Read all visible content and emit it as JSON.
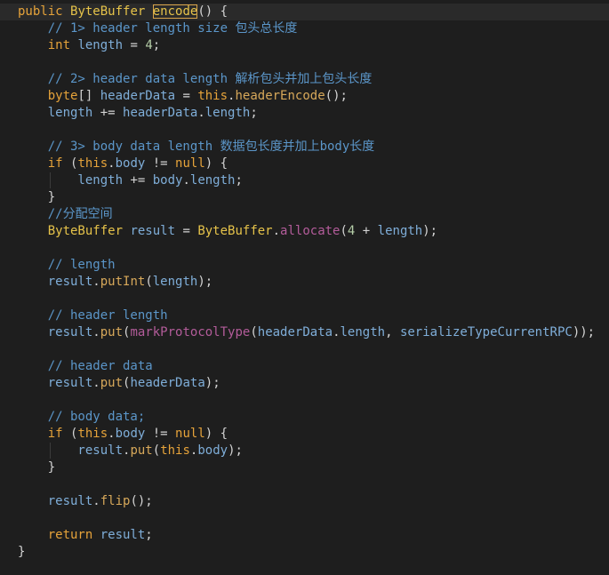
{
  "editor": {
    "lines": [
      {
        "tokens": [
          {
            "t": "public ",
            "c": "kw"
          },
          {
            "t": "ByteBuffer ",
            "c": "type"
          },
          {
            "t": "encode",
            "c": "sel"
          },
          {
            "t": "() {",
            "c": "pl"
          }
        ]
      },
      {
        "tokens": [
          {
            "t": "    // 1> header length size ",
            "c": "cm"
          },
          {
            "t": "包头总长度",
            "c": "cm"
          }
        ]
      },
      {
        "tokens": [
          {
            "t": "    int ",
            "c": "kw"
          },
          {
            "t": "length",
            "c": "var"
          },
          {
            "t": " = ",
            "c": "pl"
          },
          {
            "t": "4",
            "c": "num"
          },
          {
            "t": ";",
            "c": "pl"
          }
        ]
      },
      {
        "tokens": [
          {
            "t": "",
            "c": "pl"
          }
        ]
      },
      {
        "tokens": [
          {
            "t": "    // 2> header data length ",
            "c": "cm"
          },
          {
            "t": "解析包头并加上包头长度",
            "c": "cm"
          }
        ]
      },
      {
        "tokens": [
          {
            "t": "    byte",
            "c": "kw"
          },
          {
            "t": "[] ",
            "c": "pl"
          },
          {
            "t": "headerData",
            "c": "var"
          },
          {
            "t": " = ",
            "c": "pl"
          },
          {
            "t": "this",
            "c": "kw"
          },
          {
            "t": ".",
            "c": "pl"
          },
          {
            "t": "headerEncode",
            "c": "call"
          },
          {
            "t": "();",
            "c": "pl"
          }
        ]
      },
      {
        "tokens": [
          {
            "t": "    length",
            "c": "var"
          },
          {
            "t": " += ",
            "c": "pl"
          },
          {
            "t": "headerData",
            "c": "var"
          },
          {
            "t": ".",
            "c": "pl"
          },
          {
            "t": "length",
            "c": "field"
          },
          {
            "t": ";",
            "c": "pl"
          }
        ]
      },
      {
        "tokens": [
          {
            "t": "",
            "c": "pl"
          }
        ]
      },
      {
        "tokens": [
          {
            "t": "    // 3> body data length ",
            "c": "cm"
          },
          {
            "t": "数据包长度并加上body长度",
            "c": "cm"
          }
        ]
      },
      {
        "tokens": [
          {
            "t": "    if ",
            "c": "kw"
          },
          {
            "t": "(",
            "c": "pl"
          },
          {
            "t": "this",
            "c": "kw"
          },
          {
            "t": ".",
            "c": "pl"
          },
          {
            "t": "body",
            "c": "field"
          },
          {
            "t": " != ",
            "c": "pl"
          },
          {
            "t": "null",
            "c": "kw"
          },
          {
            "t": ") {",
            "c": "pl"
          }
        ]
      },
      {
        "tokens": [
          {
            "t": "        length",
            "c": "var"
          },
          {
            "t": " += ",
            "c": "pl"
          },
          {
            "t": "body",
            "c": "var"
          },
          {
            "t": ".",
            "c": "pl"
          },
          {
            "t": "length",
            "c": "field"
          },
          {
            "t": ";",
            "c": "pl"
          }
        ]
      },
      {
        "tokens": [
          {
            "t": "    }",
            "c": "pl"
          }
        ]
      },
      {
        "tokens": [
          {
            "t": "    //分配空间",
            "c": "cm"
          }
        ]
      },
      {
        "tokens": [
          {
            "t": "    ByteBuffer ",
            "c": "type"
          },
          {
            "t": "result",
            "c": "var"
          },
          {
            "t": " = ",
            "c": "pl"
          },
          {
            "t": "ByteBuffer",
            "c": "type"
          },
          {
            "t": ".",
            "c": "pl"
          },
          {
            "t": "allocate",
            "c": "deco"
          },
          {
            "t": "(",
            "c": "pl"
          },
          {
            "t": "4",
            "c": "num"
          },
          {
            "t": " + ",
            "c": "pl"
          },
          {
            "t": "length",
            "c": "var"
          },
          {
            "t": ");",
            "c": "pl"
          }
        ]
      },
      {
        "tokens": [
          {
            "t": "",
            "c": "pl"
          }
        ]
      },
      {
        "tokens": [
          {
            "t": "    // length",
            "c": "cm"
          }
        ]
      },
      {
        "tokens": [
          {
            "t": "    result",
            "c": "var"
          },
          {
            "t": ".",
            "c": "pl"
          },
          {
            "t": "putInt",
            "c": "call"
          },
          {
            "t": "(",
            "c": "pl"
          },
          {
            "t": "length",
            "c": "var"
          },
          {
            "t": ");",
            "c": "pl"
          }
        ]
      },
      {
        "tokens": [
          {
            "t": "",
            "c": "pl"
          }
        ]
      },
      {
        "tokens": [
          {
            "t": "    // header length",
            "c": "cm"
          }
        ]
      },
      {
        "tokens": [
          {
            "t": "    result",
            "c": "var"
          },
          {
            "t": ".",
            "c": "pl"
          },
          {
            "t": "put",
            "c": "call"
          },
          {
            "t": "(",
            "c": "pl"
          },
          {
            "t": "markProtocolType",
            "c": "deco"
          },
          {
            "t": "(",
            "c": "pl"
          },
          {
            "t": "headerData",
            "c": "var"
          },
          {
            "t": ".",
            "c": "pl"
          },
          {
            "t": "length",
            "c": "field"
          },
          {
            "t": ", ",
            "c": "pl"
          },
          {
            "t": "serializeTypeCurrentRPC",
            "c": "var"
          },
          {
            "t": "));",
            "c": "pl"
          }
        ]
      },
      {
        "tokens": [
          {
            "t": "",
            "c": "pl"
          }
        ]
      },
      {
        "tokens": [
          {
            "t": "    // header data",
            "c": "cm"
          }
        ]
      },
      {
        "tokens": [
          {
            "t": "    result",
            "c": "var"
          },
          {
            "t": ".",
            "c": "pl"
          },
          {
            "t": "put",
            "c": "call"
          },
          {
            "t": "(",
            "c": "pl"
          },
          {
            "t": "headerData",
            "c": "var"
          },
          {
            "t": ");",
            "c": "pl"
          }
        ]
      },
      {
        "tokens": [
          {
            "t": "",
            "c": "pl"
          }
        ]
      },
      {
        "tokens": [
          {
            "t": "    // body data;",
            "c": "cm"
          }
        ]
      },
      {
        "tokens": [
          {
            "t": "    if ",
            "c": "kw"
          },
          {
            "t": "(",
            "c": "pl"
          },
          {
            "t": "this",
            "c": "kw"
          },
          {
            "t": ".",
            "c": "pl"
          },
          {
            "t": "body",
            "c": "field"
          },
          {
            "t": " != ",
            "c": "pl"
          },
          {
            "t": "null",
            "c": "kw"
          },
          {
            "t": ") {",
            "c": "pl"
          }
        ]
      },
      {
        "tokens": [
          {
            "t": "        result",
            "c": "var"
          },
          {
            "t": ".",
            "c": "pl"
          },
          {
            "t": "put",
            "c": "call"
          },
          {
            "t": "(",
            "c": "pl"
          },
          {
            "t": "this",
            "c": "kw"
          },
          {
            "t": ".",
            "c": "pl"
          },
          {
            "t": "body",
            "c": "field"
          },
          {
            "t": ");",
            "c": "pl"
          }
        ]
      },
      {
        "tokens": [
          {
            "t": "    }",
            "c": "pl"
          }
        ]
      },
      {
        "tokens": [
          {
            "t": "",
            "c": "pl"
          }
        ]
      },
      {
        "tokens": [
          {
            "t": "    result",
            "c": "var"
          },
          {
            "t": ".",
            "c": "pl"
          },
          {
            "t": "flip",
            "c": "call"
          },
          {
            "t": "();",
            "c": "pl"
          }
        ]
      },
      {
        "tokens": [
          {
            "t": "",
            "c": "pl"
          }
        ]
      },
      {
        "tokens": [
          {
            "t": "    return ",
            "c": "kw"
          },
          {
            "t": "result",
            "c": "var"
          },
          {
            "t": ";",
            "c": "pl"
          }
        ]
      },
      {
        "tokens": [
          {
            "t": "}",
            "c": "pl"
          }
        ]
      }
    ]
  }
}
